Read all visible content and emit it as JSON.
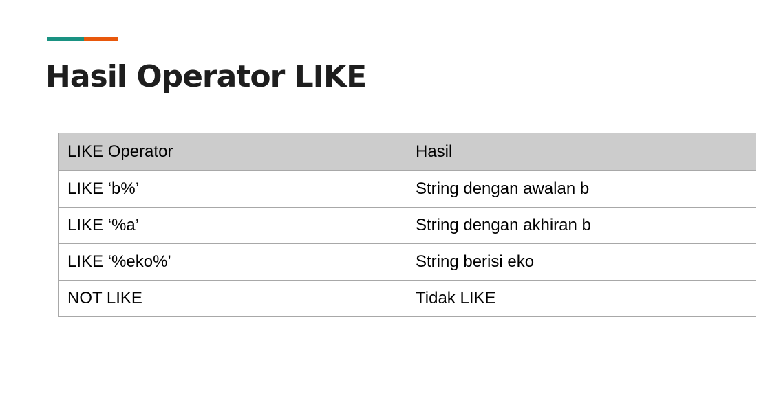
{
  "slide": {
    "title": "Hasil Operator LIKE",
    "accent_colors": [
      "#1a9282",
      "#e8580c"
    ]
  },
  "table": {
    "headers": [
      "LIKE Operator",
      "Hasil"
    ],
    "rows": [
      [
        "LIKE ‘b%’",
        "String dengan awalan b"
      ],
      [
        "LIKE ‘%a’",
        "String dengan akhiran b"
      ],
      [
        "LIKE ‘%eko%’",
        "String berisi eko"
      ],
      [
        "NOT LIKE",
        "Tidak LIKE"
      ]
    ]
  }
}
